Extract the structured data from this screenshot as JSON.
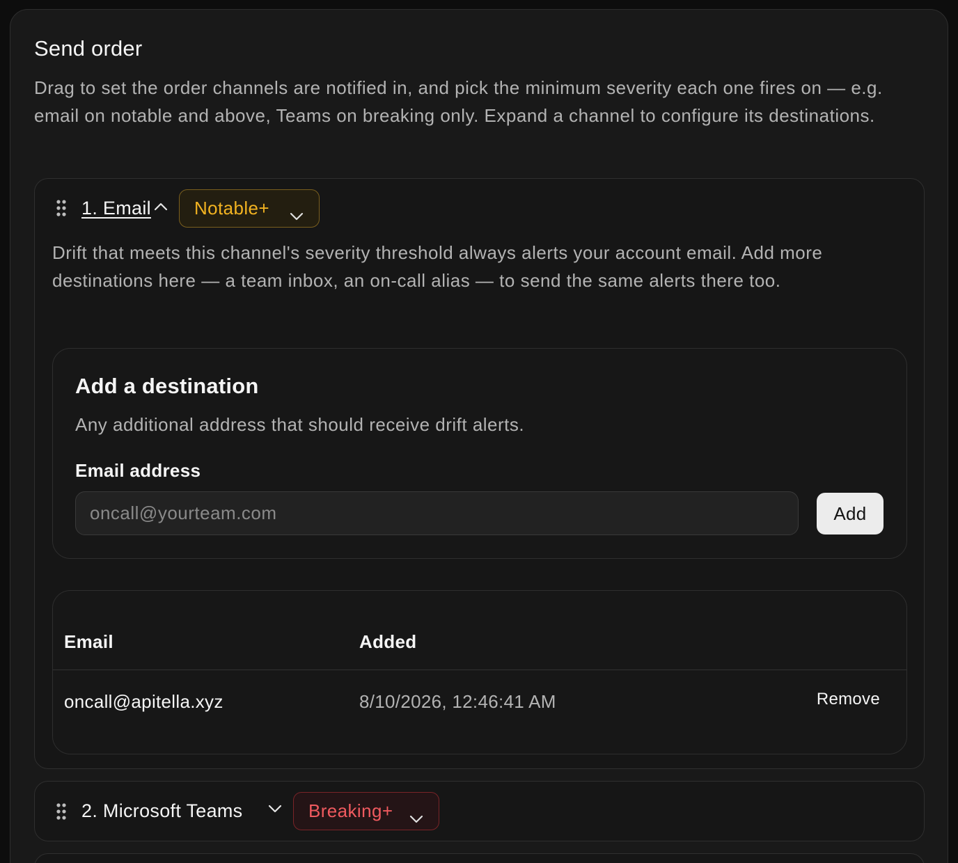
{
  "section": {
    "title": "Send order",
    "description": "Drag to set the order channels are notified in, and pick the minimum severity each one fires on — e.g. email on notable and above, Teams on breaking only. Expand a channel to configure its destinations."
  },
  "channels": [
    {
      "label": "1. Email",
      "expanded": true,
      "severity": "Notable+",
      "severity_color": "#f2b321",
      "description": "Drift that meets this channel's severity threshold always alerts your account email. Add more destinations here — a team inbox, an on-call alias — to send the same alerts there too.",
      "add_card": {
        "title": "Add a destination",
        "subtitle": "Any additional address that should receive drift alerts.",
        "field_label": "Email address",
        "input_placeholder": "oncall@yourteam.com",
        "input_value": "",
        "add_label": "Add"
      },
      "table": {
        "headers": [
          "Email",
          "Added"
        ],
        "rows": [
          {
            "email": "oncall@apitella.xyz",
            "added": "8/10/2026, 12:46:41 AM",
            "action": "Remove"
          }
        ]
      }
    },
    {
      "label": "2. Microsoft Teams",
      "expanded": false,
      "severity": "Breaking+",
      "severity_color": "#f05a5f"
    }
  ]
}
